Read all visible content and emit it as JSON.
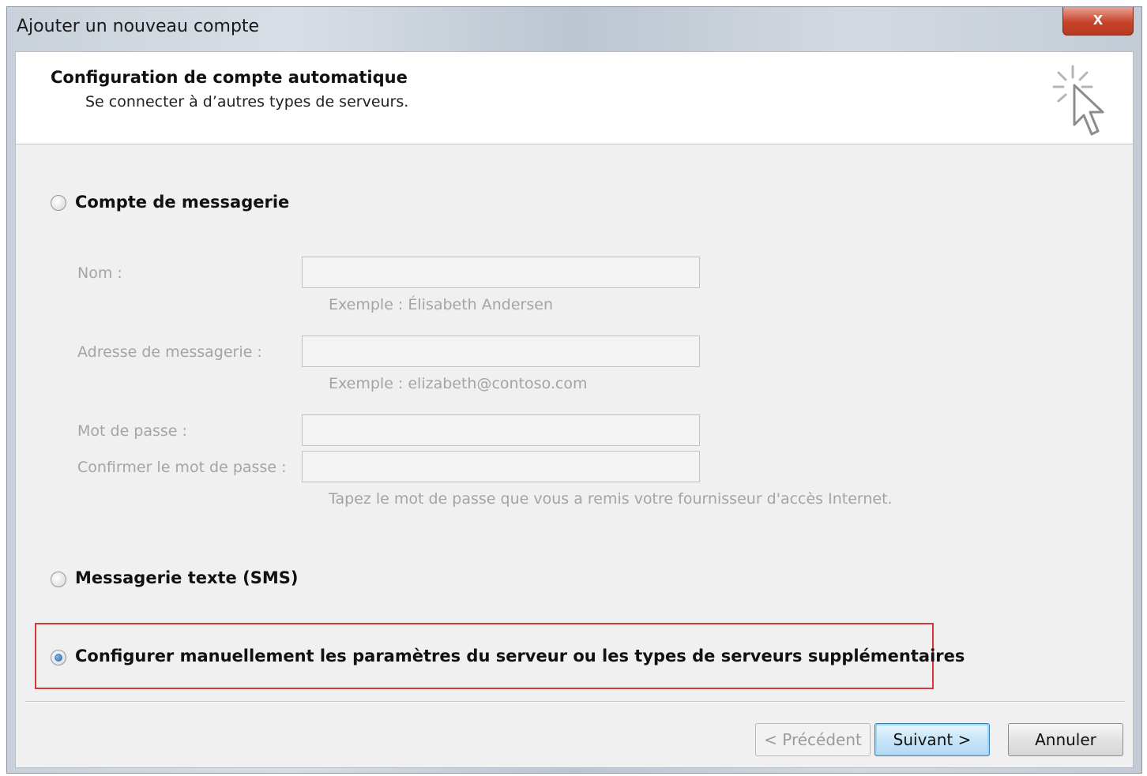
{
  "window": {
    "title": "Ajouter un nouveau compte",
    "close_label": "x"
  },
  "header": {
    "title": "Configuration de compte automatique",
    "subtitle": "Se connecter à d’autres types de serveurs.",
    "icon": "cursor-sparkle-icon"
  },
  "options": {
    "email_account": {
      "label": "Compte de messagerie",
      "selected": false
    },
    "sms": {
      "label": "Messagerie texte (SMS)",
      "selected": false
    },
    "manual": {
      "label": "Configurer manuellement les paramètres du serveur ou les types de serveurs supplémentaires",
      "selected": true
    }
  },
  "form": {
    "name_label": "Nom :",
    "name_value": "",
    "name_hint": "Exemple : Élisabeth Andersen",
    "email_label": "Adresse de messagerie :",
    "email_value": "",
    "email_hint": "Exemple : elizabeth@contoso.com",
    "password_label": "Mot de passe :",
    "password_value": "",
    "confirm_label": "Confirmer le mot de passe :",
    "confirm_value": "",
    "password_hint": "Tapez le mot de passe que vous a remis votre fournisseur d'accès Internet."
  },
  "buttons": {
    "previous": "< Précédent",
    "next": "Suivant >",
    "cancel": "Annuler"
  },
  "colors": {
    "highlight_border": "#d6383a",
    "default_button": "#3c7fb1"
  }
}
